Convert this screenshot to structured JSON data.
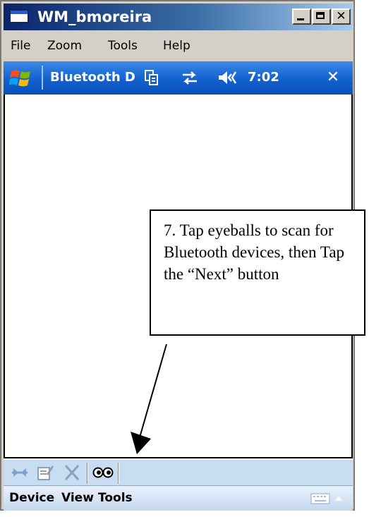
{
  "window": {
    "title": "WM_bmoreira",
    "close_glyph": "✕"
  },
  "menubar": {
    "items": [
      "File",
      "Zoom",
      "Tools",
      "Help"
    ]
  },
  "device": {
    "titlebar": {
      "title": "Bluetooth Devices",
      "time": "7:02",
      "close_glyph": "✕"
    },
    "toolbar": {
      "icons": [
        "connect-icon",
        "properties-icon",
        "delete-icon",
        "discover-eyeballs-icon"
      ]
    },
    "softkeys": {
      "items": [
        "Device",
        "View",
        "Tools"
      ]
    }
  },
  "callout": {
    "text": "7. Tap eyeballs to scan for Bluetooth devices, then Tap the “Next” button"
  },
  "colors": {
    "wm_title_blue": "#1261cf",
    "toolbar_blue": "#c8dcf2",
    "win_gray": "#d4d0c8"
  }
}
